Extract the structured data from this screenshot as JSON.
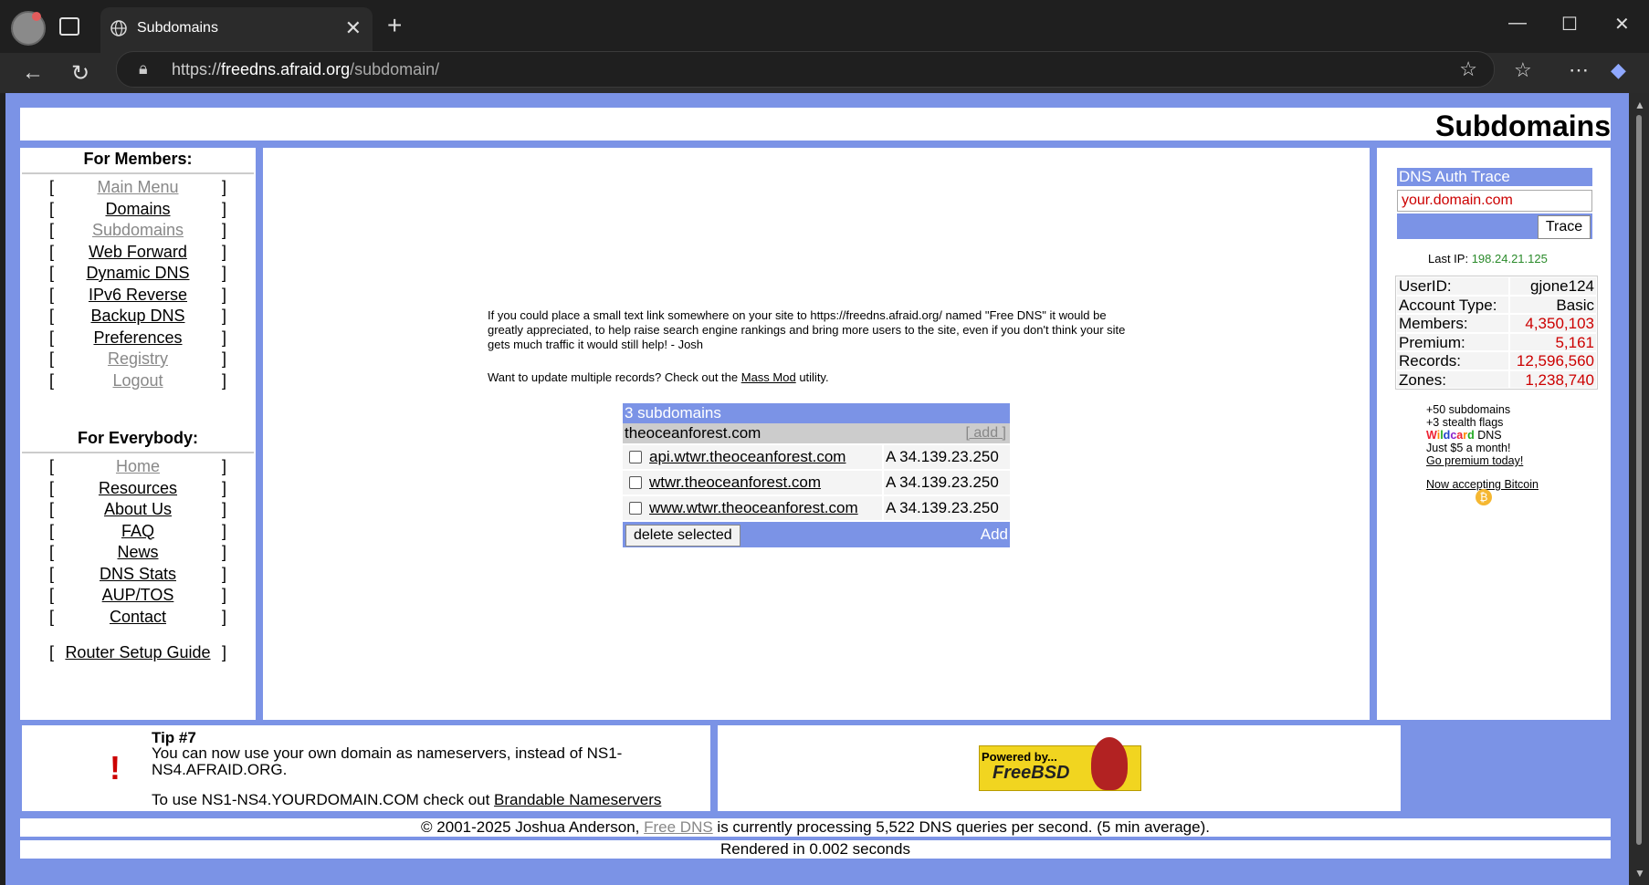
{
  "browser": {
    "tab_title": "Subdomains",
    "url_scheme": "https://",
    "url_host": "freedns.afraid.org",
    "url_path": "/subdomain/"
  },
  "header": {
    "title": "Subdomains"
  },
  "members": {
    "heading": "For Members:",
    "items": [
      "Main Menu",
      "Domains",
      "Subdomains",
      "Web Forward",
      "Dynamic DNS",
      "IPv6 Reverse",
      "Backup DNS",
      "Preferences",
      "Registry",
      "Logout"
    ]
  },
  "everybody": {
    "heading": "For Everybody:",
    "items": [
      "Home",
      "Resources",
      "About Us",
      "FAQ",
      "News",
      "DNS Stats",
      "AUP/TOS",
      "Contact"
    ],
    "router_guide": "Router Setup Guide"
  },
  "main": {
    "intro": "If you could place a small text link somewhere on your site to https://freedns.afraid.org/ named \"Free DNS\" it would be greatly appreciated, to help raise search engine rankings and bring more users to the site, even if you don't think your site gets much traffic it would still help! - Josh",
    "massmod_prefix": "Want to update multiple records? Check out the ",
    "massmod_link": "Mass Mod",
    "massmod_suffix": " utility.",
    "table": {
      "count_label": "3 subdomains",
      "domain": "theoceanforest.com",
      "add_link": "[ add ]",
      "rows": [
        {
          "name": "api.wtwr.theoceanforest.com",
          "record": "A 34.139.23.250"
        },
        {
          "name": "wtwr.theoceanforest.com",
          "record": "A 34.139.23.250"
        },
        {
          "name": "www.wtwr.theoceanforest.com",
          "record": "A 34.139.23.250"
        }
      ],
      "delete_label": "delete selected",
      "add_label": "Add"
    }
  },
  "right": {
    "trace_heading": "DNS Auth Trace",
    "trace_input": "your.domain.com",
    "trace_button": "Trace",
    "last_ip_label": "Last IP: ",
    "last_ip": "198.24.21.125",
    "stats": [
      {
        "k": "UserID:",
        "v": "gjone124",
        "red": false
      },
      {
        "k": "Account Type:",
        "v": "Basic",
        "red": false
      },
      {
        "k": "Members:",
        "v": "4,350,103",
        "red": true
      },
      {
        "k": "Premium:",
        "v": "5,161",
        "red": true
      },
      {
        "k": "Records:",
        "v": "12,596,560",
        "red": true
      },
      {
        "k": "Zones:",
        "v": "1,238,740",
        "red": true
      }
    ],
    "promo1": "+50 subdomains",
    "promo2": "+3 stealth flags",
    "promo3_wild": "Wildcard",
    "promo3_rest": " DNS",
    "promo4": "Just $5 a month!",
    "promo5": "Go premium today!",
    "bitcoin": "Now accepting Bitcoin"
  },
  "tip": {
    "title": "Tip #7",
    "text": "You can now use your own domain as nameservers, instead of NS1-NS4.AFRAID.ORG.",
    "text2_prefix": "To use NS1-NS4.YOURDOMAIN.COM check out ",
    "text2_link": "Brandable Nameservers"
  },
  "badge": {
    "powered": "Powered by...",
    "name": "FreeBSD"
  },
  "footer": {
    "copy": "© 2001-2025 Joshua Anderson, ",
    "link": "Free DNS",
    "rest": " is currently processing 5,522 DNS queries per second. (5 min average).",
    "rendered": "Rendered in 0.002 seconds"
  }
}
